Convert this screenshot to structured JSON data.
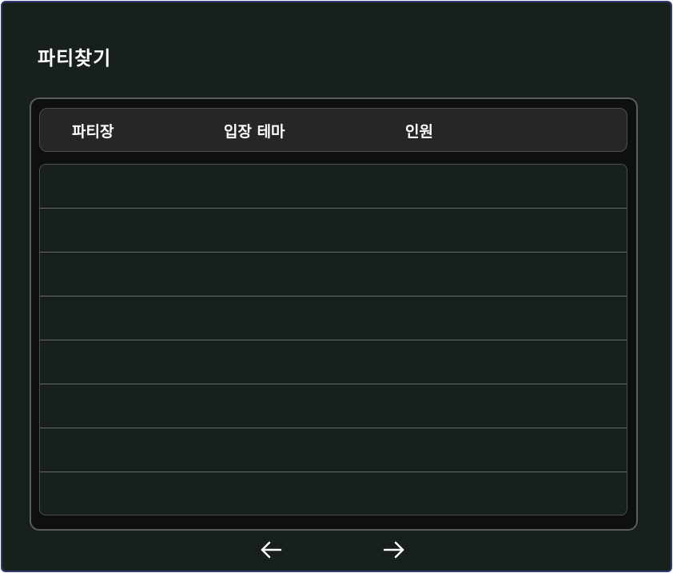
{
  "window": {
    "title": "파티찾기"
  },
  "table": {
    "columns": [
      "파티장",
      "입장 테마",
      "인원"
    ],
    "rows": [
      {
        "host": "",
        "theme": "",
        "count": ""
      },
      {
        "host": "",
        "theme": "",
        "count": ""
      },
      {
        "host": "",
        "theme": "",
        "count": ""
      },
      {
        "host": "",
        "theme": "",
        "count": ""
      },
      {
        "host": "",
        "theme": "",
        "count": ""
      },
      {
        "host": "",
        "theme": "",
        "count": ""
      },
      {
        "host": "",
        "theme": "",
        "count": ""
      },
      {
        "host": "",
        "theme": "",
        "count": ""
      }
    ]
  },
  "pagination": {
    "prev_icon": "arrow-left-icon",
    "next_icon": "arrow-right-icon"
  },
  "colors": {
    "background": "#17201a",
    "panel": "#0d100e",
    "header": "#262626",
    "window_border": "#2f3a7a",
    "text": "#ffffff"
  }
}
